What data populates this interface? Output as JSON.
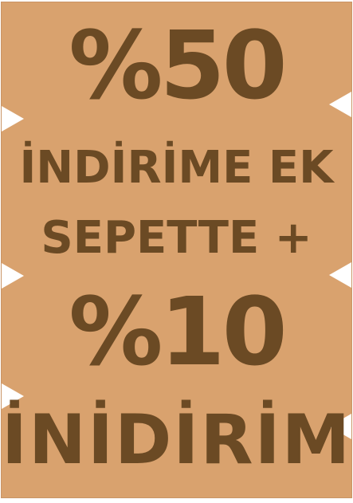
{
  "banner": {
    "line1": "%50",
    "line2": "İNDİRİME EK",
    "line3": "SEPETTE +",
    "line4": "%10",
    "line5": "İNİDİRİM"
  },
  "colors": {
    "background": "#d9a26e",
    "text": "#6b4a24",
    "notch": "#ffffff"
  }
}
